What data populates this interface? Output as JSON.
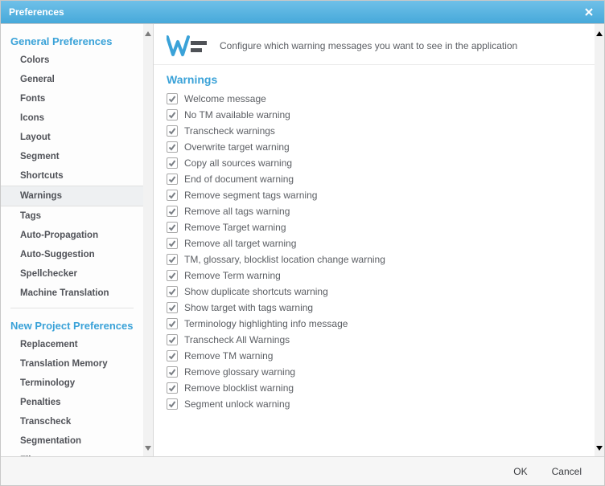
{
  "window": {
    "title": "Preferences"
  },
  "sidebar": {
    "groups": [
      {
        "header": "General Preferences",
        "items": [
          {
            "label": "Colors",
            "selected": false
          },
          {
            "label": "General",
            "selected": false
          },
          {
            "label": "Fonts",
            "selected": false
          },
          {
            "label": "Icons",
            "selected": false
          },
          {
            "label": "Layout",
            "selected": false
          },
          {
            "label": "Segment",
            "selected": false
          },
          {
            "label": "Shortcuts",
            "selected": false
          },
          {
            "label": "Warnings",
            "selected": true
          },
          {
            "label": "Tags",
            "selected": false
          },
          {
            "label": "Auto-Propagation",
            "selected": false
          },
          {
            "label": "Auto-Suggestion",
            "selected": false
          },
          {
            "label": "Spellchecker",
            "selected": false
          },
          {
            "label": "Machine Translation",
            "selected": false
          }
        ]
      },
      {
        "header": "New Project Preferences",
        "items": [
          {
            "label": "Replacement",
            "selected": false
          },
          {
            "label": "Translation Memory",
            "selected": false
          },
          {
            "label": "Terminology",
            "selected": false
          },
          {
            "label": "Penalties",
            "selected": false
          },
          {
            "label": "Transcheck",
            "selected": false
          },
          {
            "label": "Segmentation",
            "selected": false
          },
          {
            "label": "Filters",
            "selected": false
          }
        ]
      }
    ]
  },
  "content": {
    "banner_text": "Configure which warning messages you want to see in the application",
    "section_title": "Warnings",
    "checks": [
      {
        "label": "Welcome message",
        "checked": true
      },
      {
        "label": "No TM available warning",
        "checked": true
      },
      {
        "label": "Transcheck warnings",
        "checked": true
      },
      {
        "label": "Overwrite target warning",
        "checked": true
      },
      {
        "label": "Copy all sources warning",
        "checked": true
      },
      {
        "label": "End of document warning",
        "checked": true
      },
      {
        "label": "Remove segment tags warning",
        "checked": true
      },
      {
        "label": "Remove all tags warning",
        "checked": true
      },
      {
        "label": "Remove Target warning",
        "checked": true
      },
      {
        "label": "Remove all target warning",
        "checked": true
      },
      {
        "label": "TM, glossary, blocklist location change warning",
        "checked": true
      },
      {
        "label": "Remove Term warning",
        "checked": true
      },
      {
        "label": "Show duplicate shortcuts warning",
        "checked": true
      },
      {
        "label": "Show target with tags warning",
        "checked": true
      },
      {
        "label": "Terminology highlighting info message",
        "checked": true
      },
      {
        "label": "Transcheck All Warnings",
        "checked": true
      },
      {
        "label": "Remove TM warning",
        "checked": true
      },
      {
        "label": "Remove glossary warning",
        "checked": true
      },
      {
        "label": "Remove blocklist warning",
        "checked": true
      },
      {
        "label": "Segment unlock warning",
        "checked": true
      }
    ]
  },
  "footer": {
    "ok": "OK",
    "cancel": "Cancel"
  }
}
